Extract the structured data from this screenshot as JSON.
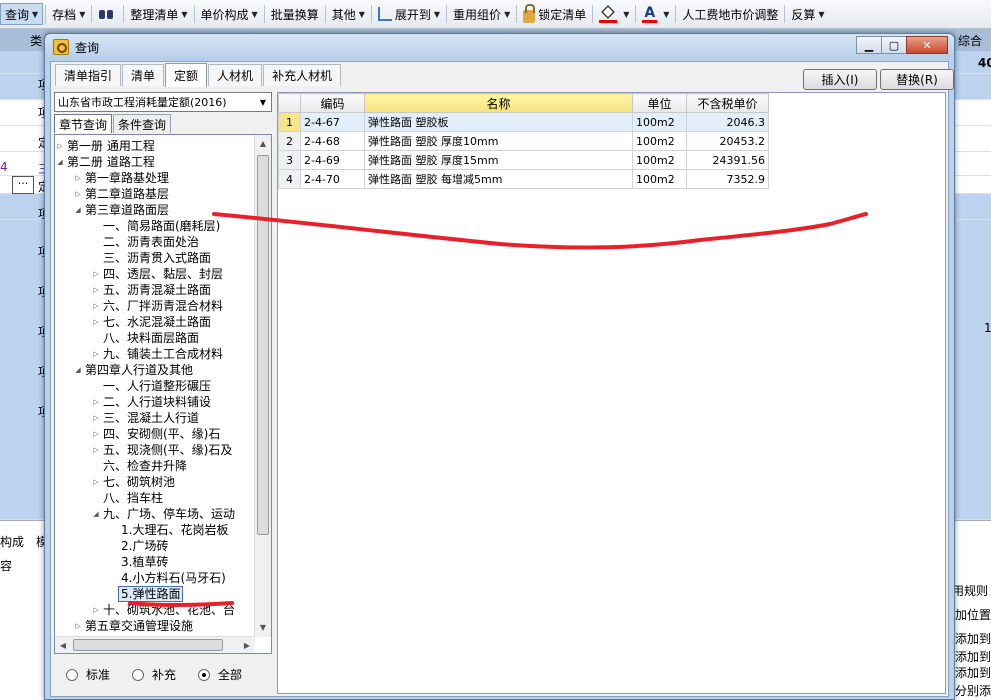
{
  "toolbar": {
    "items": [
      {
        "label": "查询",
        "arrow": true,
        "active": true
      },
      {
        "label": "存档",
        "arrow": true
      },
      {
        "label": "",
        "icon": "binoculars-icon"
      },
      {
        "label": "整理清单",
        "arrow": true
      },
      {
        "label": "单价构成",
        "arrow": true
      },
      {
        "label": "批量换算"
      },
      {
        "label": "其他",
        "arrow": true
      },
      {
        "label": "展开到",
        "arrow": true,
        "icon": "tree-expand-icon"
      },
      {
        "label": "重用组价",
        "arrow": true
      },
      {
        "label": "锁定清单",
        "icon": "lock-icon"
      },
      {
        "label": "",
        "arrow": true,
        "icon": "fill-color-icon"
      },
      {
        "label": "",
        "arrow": true,
        "icon": "font-color-icon"
      },
      {
        "label": "人工费地市价调整"
      },
      {
        "label": "反算",
        "arrow": true
      }
    ]
  },
  "background": {
    "header_left": "类",
    "header_right": "综合",
    "right_value_1": "40",
    "right_value_2": "1",
    "left_rows": [
      "项",
      "项",
      "定",
      "4",
      "三",
      "定",
      "项",
      "项",
      "项",
      "项",
      "项",
      "项"
    ],
    "bottom_left": [
      "构成",
      "模",
      "容"
    ],
    "bottom_right": [
      "用规则",
      "加位置",
      "添加到",
      "添加到",
      "添加到",
      "分别添"
    ]
  },
  "dialog": {
    "title": "查询",
    "buttons": {
      "insert": "插入(I)",
      "replace": "替换(R)"
    },
    "tabs": [
      {
        "label": "清单指引",
        "active": false
      },
      {
        "label": "清单",
        "active": false
      },
      {
        "label": "定额",
        "active": true
      },
      {
        "label": "人材机",
        "active": false
      },
      {
        "label": "补充人材机",
        "active": false
      }
    ],
    "library": "山东省市政工程消耗量定额(2016)",
    "subtabs": [
      {
        "label": "章节查询",
        "active": true
      },
      {
        "label": "条件查询",
        "active": false
      }
    ],
    "tree": [
      {
        "label": "第一册 通用工程",
        "level": 0,
        "toggle": "▷"
      },
      {
        "label": "第二册 道路工程",
        "level": 0,
        "toggle": "◢"
      },
      {
        "label": "第一章路基处理",
        "level": 1,
        "toggle": "▷"
      },
      {
        "label": "第二章道路基层",
        "level": 1,
        "toggle": "▷"
      },
      {
        "label": "第三章道路面层",
        "level": 1,
        "toggle": "◢"
      },
      {
        "label": "一、简易路面(磨耗层)",
        "level": 2,
        "toggle": ""
      },
      {
        "label": "二、沥青表面处治",
        "level": 2,
        "toggle": ""
      },
      {
        "label": "三、沥青贯入式路面",
        "level": 2,
        "toggle": ""
      },
      {
        "label": "四、透层、黏层、封层",
        "level": 2,
        "toggle": "▷"
      },
      {
        "label": "五、沥青混凝土路面",
        "level": 2,
        "toggle": "▷"
      },
      {
        "label": "六、厂拌沥青混合材料",
        "level": 2,
        "toggle": "▷"
      },
      {
        "label": "七、水泥混凝土路面",
        "level": 2,
        "toggle": "▷"
      },
      {
        "label": "八、块料面层路面",
        "level": 2,
        "toggle": ""
      },
      {
        "label": "九、铺装土工合成材料",
        "level": 2,
        "toggle": "▷"
      },
      {
        "label": "第四章人行道及其他",
        "level": 1,
        "toggle": "◢"
      },
      {
        "label": "一、人行道整形碾压",
        "level": 2,
        "toggle": ""
      },
      {
        "label": "二、人行道块料铺设",
        "level": 2,
        "toggle": "▷"
      },
      {
        "label": "三、混凝土人行道",
        "level": 2,
        "toggle": "▷"
      },
      {
        "label": "四、安砌侧(平、缘)石",
        "level": 2,
        "toggle": "▷"
      },
      {
        "label": "五、现浇侧(平、缘)石及",
        "level": 2,
        "toggle": "▷"
      },
      {
        "label": "六、检查井升降",
        "level": 2,
        "toggle": ""
      },
      {
        "label": "七、砌筑树池",
        "level": 2,
        "toggle": "▷"
      },
      {
        "label": "八、挡车柱",
        "level": 2,
        "toggle": ""
      },
      {
        "label": "九、广场、停车场、运动",
        "level": 2,
        "toggle": "◢"
      },
      {
        "label": "1.大理石、花岗岩板",
        "level": 3,
        "toggle": ""
      },
      {
        "label": "2.广场砖",
        "level": 3,
        "toggle": ""
      },
      {
        "label": "3.植草砖",
        "level": 3,
        "toggle": ""
      },
      {
        "label": "4.小方料石(马牙石)",
        "level": 3,
        "toggle": ""
      },
      {
        "label": "5.弹性路面",
        "level": 3,
        "toggle": "",
        "selected": true
      },
      {
        "label": "十、砌筑水池、花池、台",
        "level": 2,
        "toggle": "▷"
      },
      {
        "label": "第五章交通管理设施",
        "level": 1,
        "toggle": "▷"
      }
    ],
    "radios": [
      {
        "label": "标准",
        "checked": false
      },
      {
        "label": "补充",
        "checked": false
      },
      {
        "label": "全部",
        "checked": true
      }
    ],
    "grid": {
      "columns": [
        "编码",
        "名称",
        "单位",
        "不含税单价"
      ],
      "rows": [
        {
          "no": "1",
          "code": "2-4-67",
          "name": "弹性路面 塑胶板",
          "unit": "100m2",
          "price": "2046.3"
        },
        {
          "no": "2",
          "code": "2-4-68",
          "name": "弹性路面 塑胶 厚度10mm",
          "unit": "100m2",
          "price": "20453.2"
        },
        {
          "no": "3",
          "code": "2-4-69",
          "name": "弹性路面 塑胶 厚度15mm",
          "unit": "100m2",
          "price": "24391.56"
        },
        {
          "no": "4",
          "code": "2-4-70",
          "name": "弹性路面 塑胶 每增减5mm",
          "unit": "100m2",
          "price": "7352.9"
        }
      ]
    }
  },
  "colors": {
    "annotation": "#e8202a",
    "band_blue": "#bcd3ef",
    "header_blue": "#a7bdd8"
  }
}
